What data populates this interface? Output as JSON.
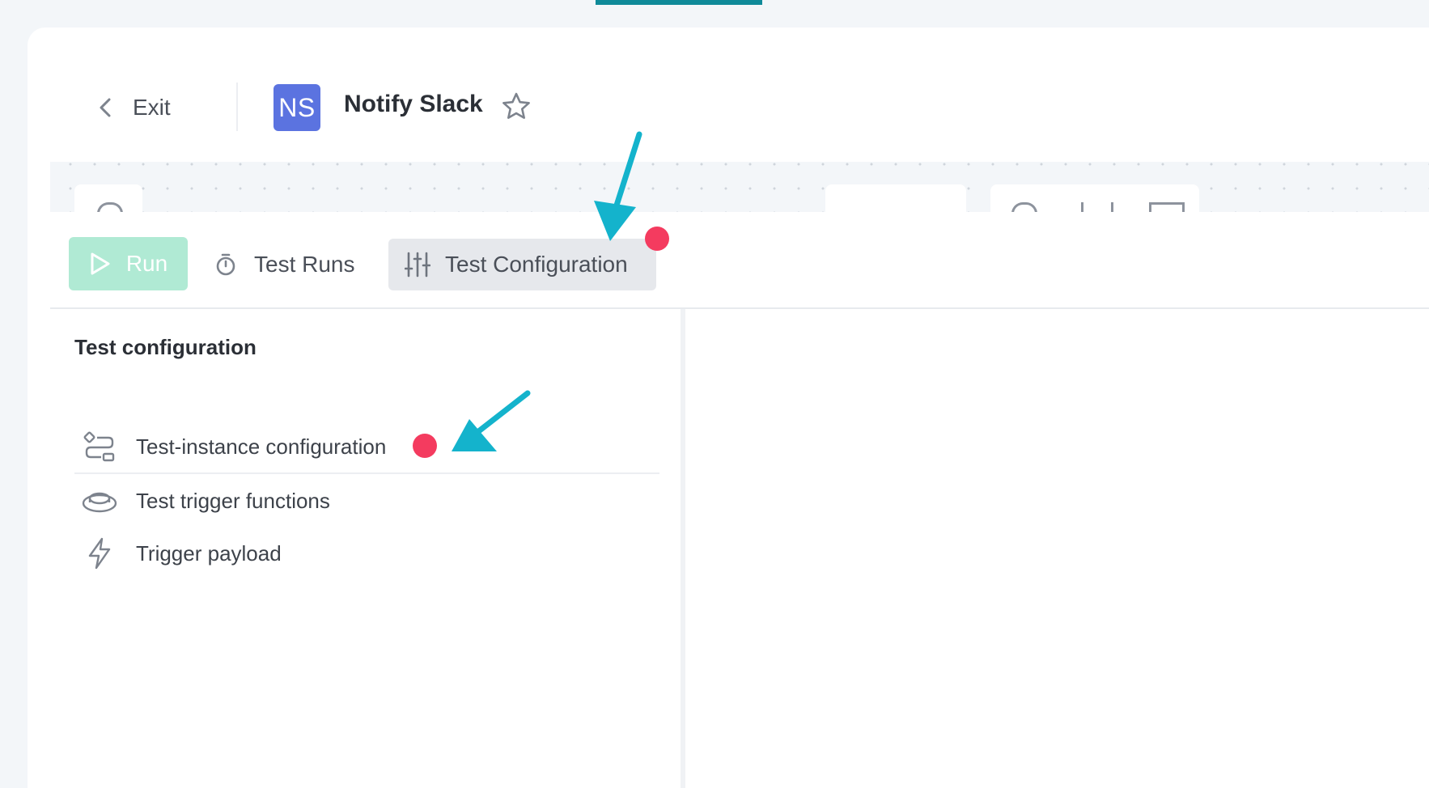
{
  "header": {
    "exit_label": "Exit",
    "avatar_initials": "NS",
    "title": "Notify Slack"
  },
  "toolbar": {
    "run_label": "Run",
    "test_runs_label": "Test Runs",
    "test_config_label": "Test Configuration"
  },
  "panel": {
    "title": "Test configuration",
    "items": [
      {
        "label": "Test-instance configuration",
        "icon": "instance-config-icon"
      },
      {
        "label": "Test trigger functions",
        "icon": "trigger-button-icon"
      },
      {
        "label": "Trigger payload",
        "icon": "lightning-bolt-icon"
      }
    ]
  },
  "colors": {
    "accent_teal": "#0f8a99",
    "avatar_bg": "#5b73e0",
    "run_bg": "#b0ead4",
    "alert_dot": "#f43b5f",
    "annotation_arrow": "#14b3cc"
  }
}
